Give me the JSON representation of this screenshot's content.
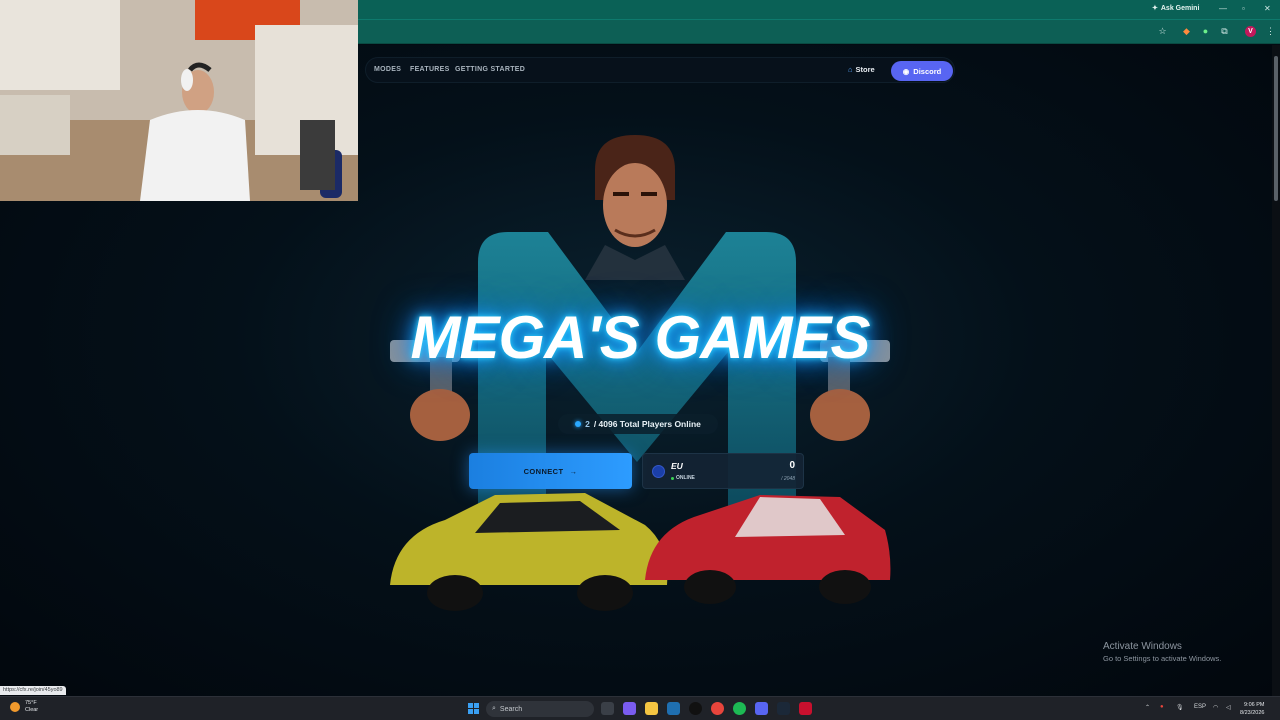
{
  "browser": {
    "ask_gemini": "Ask Gemini",
    "profile_initial": "V"
  },
  "nav": {
    "links": [
      "MODES",
      "FEATURES",
      "GETTING STARTED"
    ],
    "store": "Store",
    "discord": "Discord"
  },
  "hero": {
    "title": "MEGA'S GAMES",
    "players_current": "2",
    "players_rest": "/ 4096 Total Players Online",
    "connect": "CONNECT",
    "connect_arrow": "→"
  },
  "server": {
    "region": "EU",
    "status": "ONLINE",
    "count": "0",
    "max": "/ 2048"
  },
  "status_url": "https://cfx.re/join/45yo89",
  "activate": {
    "title": "Activate Windows",
    "subtitle": "Go to Settings to activate Windows."
  },
  "taskbar": {
    "weather_temp": "75°F",
    "weather_desc": "Clear",
    "search": "Search",
    "lang": "ESP",
    "time": "9:06 PM",
    "date": "8/23/2026"
  },
  "colors": {
    "accent": "#2d9cff",
    "discord": "#5865f2",
    "browser_frame": "#0a6156"
  }
}
